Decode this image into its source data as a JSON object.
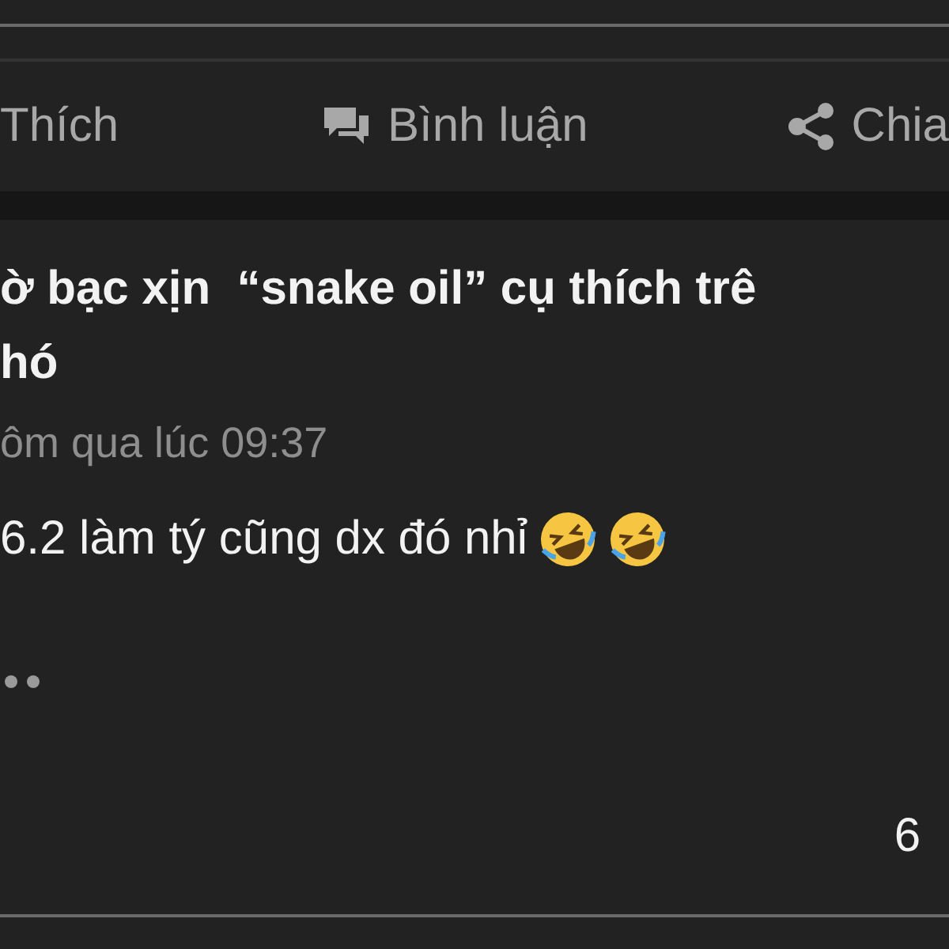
{
  "actions": [
    {
      "kind": "like",
      "label": "Thích"
    },
    {
      "kind": "comment",
      "label": "Bình luận"
    },
    {
      "kind": "share",
      "label": "Chia"
    }
  ],
  "post": {
    "title_lines": [
      "ờ bạc xịn  “snake oil” cụ thích trê",
      "hó"
    ],
    "time": "ôm qua lúc 09:37",
    "body": [
      {
        "kind": "text",
        "text": "6.2 làm tý cũng dx đó nhỉ"
      },
      {
        "kind": "emoji"
      },
      {
        "kind": "emoji"
      }
    ],
    "more": {
      "kind": "dots"
    },
    "count": "6"
  }
}
